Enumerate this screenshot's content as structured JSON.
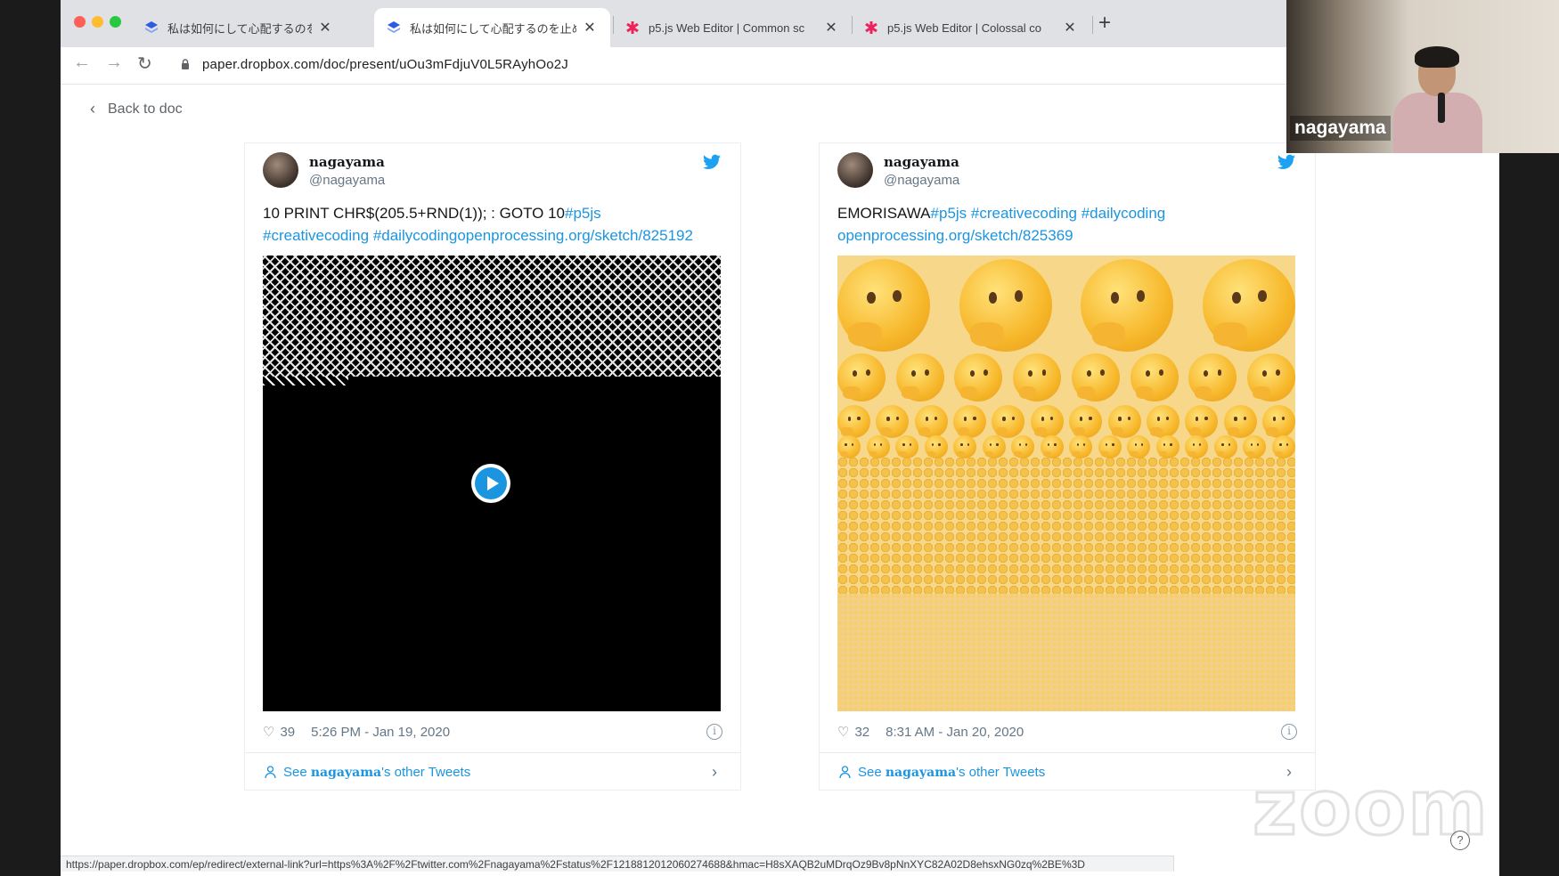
{
  "browser": {
    "tabs": [
      {
        "title": "私は如何にして心配するのを止め",
        "favicon": "dropbox-paper-icon",
        "active": false
      },
      {
        "title": "私は如何にして心配するのを止め",
        "favicon": "dropbox-paper-icon",
        "active": true
      },
      {
        "title": "p5.js Web Editor | Common sc",
        "favicon": "p5js-asterisk-icon",
        "active": false
      },
      {
        "title": "p5.js Web Editor | Colossal co",
        "favicon": "p5js-asterisk-icon",
        "active": false
      }
    ],
    "url": "paper.dropbox.com/doc/present/uOu3mFdjuV0L5RAyhOo2J",
    "status_url": "https://paper.dropbox.com/ep/redirect/external-link?url=https%3A%2F%2Ftwitter.com%2Fnagayama%2Fstatus%2F1218812012060274688&hmac=H8sXAQB2uMDrqOz9Bv8pNnXYC82A02D8ehsxNG0zq%2BE%3D"
  },
  "page": {
    "back_label": "Back to doc"
  },
  "tweets": [
    {
      "name": "nagayama",
      "handle": "@nagayama",
      "text_plain": "10 PRINT CHR$(205.5+RND(1)); : GOTO 10",
      "text_links": [
        "#p5js",
        "#creativecoding",
        "#dailycoding",
        "openprocessing.org/sketch/825192"
      ],
      "likes": "39",
      "timestamp": "5:26 PM - Jan 19, 2020",
      "more_prefix": "See ",
      "more_user": "nagayama",
      "more_suffix": "'s other Tweets",
      "media": "video"
    },
    {
      "name": "nagayama",
      "handle": "@nagayama",
      "text_plain": "EMORISAWA",
      "text_links": [
        "#p5js",
        "#creativecoding",
        "#dailycoding",
        "openprocessing.org/sketch/825369"
      ],
      "likes": "32",
      "timestamp": "8:31 AM - Jan 20, 2020",
      "more_prefix": "See ",
      "more_user": "nagayama",
      "more_suffix": "'s other Tweets",
      "media": "image"
    }
  ],
  "webcam": {
    "participant_name": "nagayama"
  },
  "watermark": "zoom",
  "colors": {
    "twitter_blue": "#1b95e0",
    "link_blue": "#1b95e0",
    "traffic_red": "#ff5f57",
    "traffic_yellow": "#febc2e",
    "traffic_green": "#28c840"
  }
}
